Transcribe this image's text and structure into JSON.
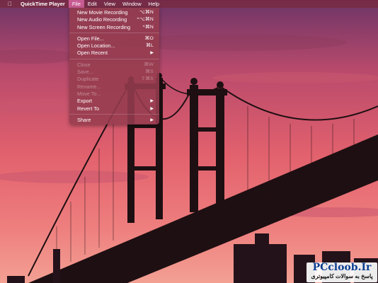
{
  "menubar": {
    "apple_icon": "apple-logo-icon",
    "app_name": "QuickTime Player",
    "menus": [
      "File",
      "Edit",
      "View",
      "Window",
      "Help"
    ],
    "active_menu": "File"
  },
  "file_menu": {
    "items": [
      {
        "label": "New Movie Recording",
        "shortcut": "⌥⌘N",
        "enabled": true
      },
      {
        "label": "New Audio Recording",
        "shortcut": "^⌥⌘N",
        "enabled": true
      },
      {
        "label": "New Screen Recording",
        "shortcut": "^⌘N",
        "enabled": true
      },
      {
        "label": "Open File...",
        "shortcut": "⌘O",
        "enabled": true
      },
      {
        "label": "Open Location...",
        "shortcut": "⌘L",
        "enabled": true
      },
      {
        "label": "Open Recent",
        "submenu": true,
        "enabled": true
      },
      {
        "label": "Close",
        "shortcut": "⌘W",
        "enabled": false
      },
      {
        "label": "Save...",
        "shortcut": "⌘S",
        "enabled": false
      },
      {
        "label": "Duplicate",
        "shortcut": "⇧⌘S",
        "enabled": false
      },
      {
        "label": "Rename...",
        "shortcut": "",
        "enabled": false
      },
      {
        "label": "Move To...",
        "shortcut": "",
        "enabled": false
      },
      {
        "label": "Export",
        "submenu": true,
        "enabled": true
      },
      {
        "label": "Revert To",
        "submenu": true,
        "enabled": true
      },
      {
        "label": "Share",
        "submenu": true,
        "enabled": true
      }
    ],
    "submenu_arrow": "▶"
  },
  "watermark": {
    "title": "PCcloob.Ir",
    "subtitle": "پاسخ به سوالات کامپیوتری"
  },
  "colors": {
    "menubar_bg": "#782838",
    "active_menu_bg": "#c85b92",
    "sky_top": "#7a3a6a",
    "sky_mid": "#d9566a",
    "sky_low": "#f08a8a",
    "bridge": "#1e0f12"
  }
}
